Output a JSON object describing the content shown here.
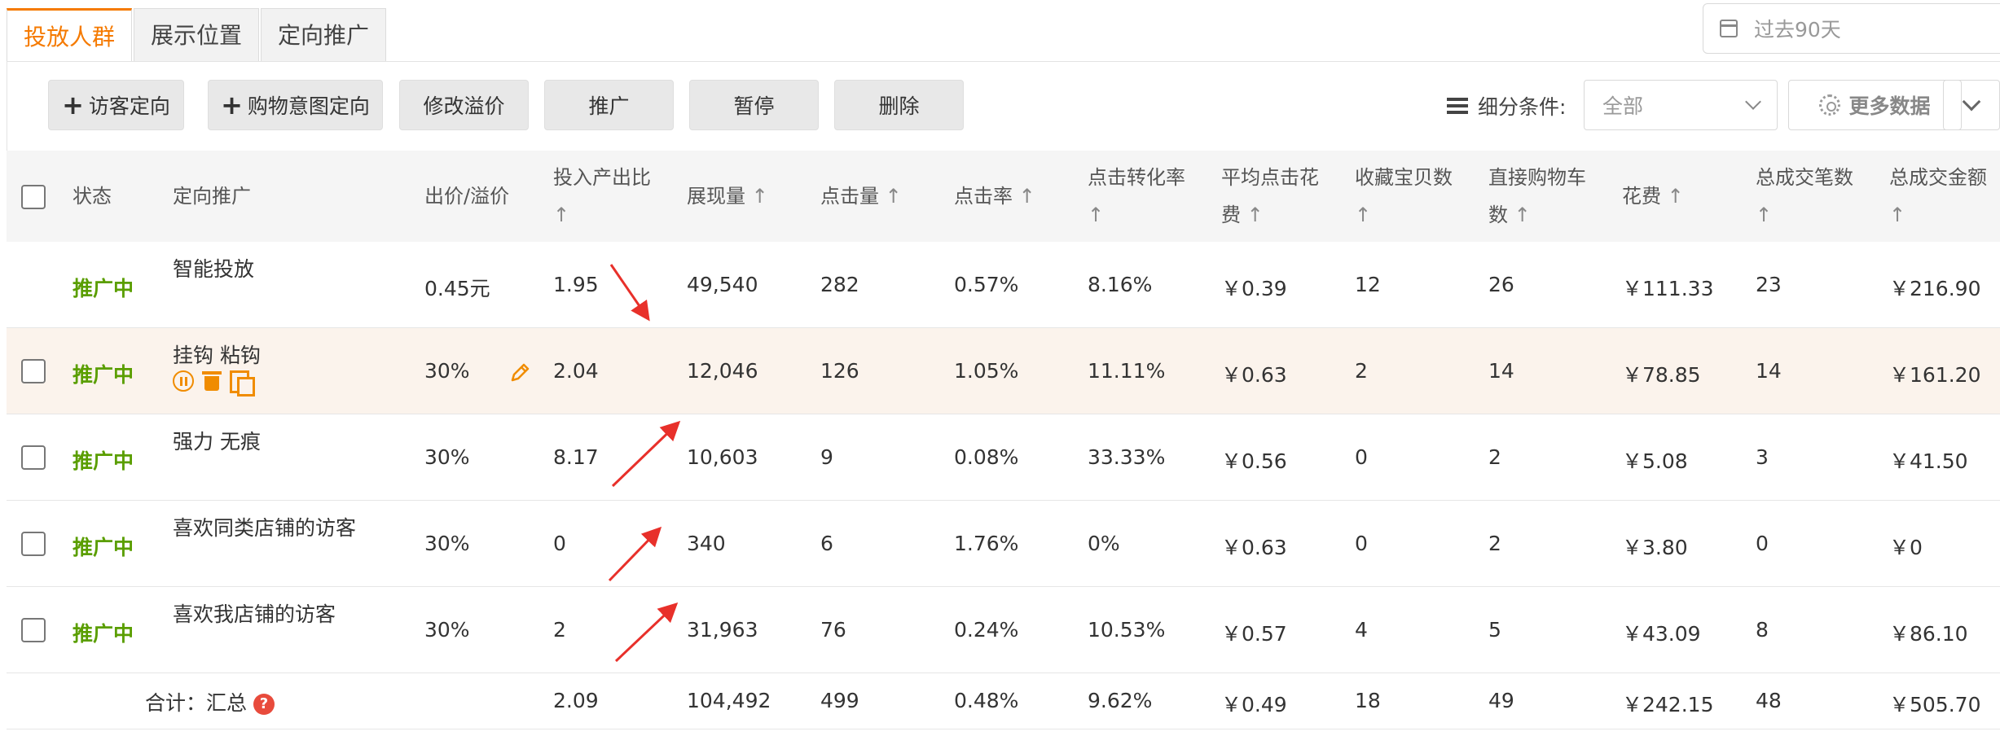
{
  "tabs": [
    {
      "label": "投放人群",
      "active": true
    },
    {
      "label": "展示位置",
      "active": false
    },
    {
      "label": "定向推广",
      "active": false
    }
  ],
  "date_range": {
    "label": "过去90天"
  },
  "toolbar": {
    "visitor_targeting": "访客定向",
    "intent_targeting": "购物意图定向",
    "modify_premium": "修改溢价",
    "promote": "推广",
    "pause": "暂停",
    "delete": "删除"
  },
  "filter": {
    "label": "细分条件:",
    "selected": "全部"
  },
  "more_data": "更多数据",
  "columns": {
    "status": "状态",
    "targeting": "定向推广",
    "bid": "出价/溢价",
    "roi": "投入产出比",
    "impressions": "展现量",
    "clicks": "点击量",
    "ctr": "点击率",
    "cvr": "点击转化率",
    "cpc_1": "平均点击花",
    "cpc_2": "费",
    "favorites": "收藏宝贝数",
    "cart_1": "直接购物车",
    "cart_2": "数",
    "cost": "花费",
    "orders_1": "总成交笔数",
    "amount": "总成交金额",
    "sort_arrow": "↑"
  },
  "rows": [
    {
      "status": "推广中",
      "name": "智能投放",
      "bid": "0.45元",
      "roi": "1.95",
      "impressions": "49,540",
      "clicks": "282",
      "ctr": "0.57%",
      "cvr": "8.16%",
      "cpc": "￥0.39",
      "favorites": "12",
      "cart": "26",
      "cost": "￥111.33",
      "orders": "23",
      "amount": "￥216.90"
    },
    {
      "status": "推广中",
      "name": "挂钩 粘钩",
      "bid": "30%",
      "roi": "2.04",
      "impressions": "12,046",
      "clicks": "126",
      "ctr": "1.05%",
      "cvr": "11.11%",
      "cpc": "￥0.63",
      "favorites": "2",
      "cart": "14",
      "cost": "￥78.85",
      "orders": "14",
      "amount": "￥161.20"
    },
    {
      "status": "推广中",
      "name": "强力 无痕",
      "bid": "30%",
      "roi": "8.17",
      "impressions": "10,603",
      "clicks": "9",
      "ctr": "0.08%",
      "cvr": "33.33%",
      "cpc": "￥0.56",
      "favorites": "0",
      "cart": "2",
      "cost": "￥5.08",
      "orders": "3",
      "amount": "￥41.50"
    },
    {
      "status": "推广中",
      "name": "喜欢同类店铺的访客",
      "bid": "30%",
      "roi": "0",
      "impressions": "340",
      "clicks": "6",
      "ctr": "1.76%",
      "cvr": "0%",
      "cpc": "￥0.63",
      "favorites": "0",
      "cart": "2",
      "cost": "￥3.80",
      "orders": "0",
      "amount": "￥0"
    },
    {
      "status": "推广中",
      "name": "喜欢我店铺的访客",
      "bid": "30%",
      "roi": "2",
      "impressions": "31,963",
      "clicks": "76",
      "ctr": "0.24%",
      "cvr": "10.53%",
      "cpc": "￥0.57",
      "favorites": "4",
      "cart": "5",
      "cost": "￥43.09",
      "orders": "8",
      "amount": "￥86.10"
    }
  ],
  "summary": {
    "label": "合计：汇总",
    "help": "?",
    "roi": "2.09",
    "impressions": "104,492",
    "clicks": "499",
    "ctr": "0.48%",
    "cvr": "9.62%",
    "cpc": "￥0.49",
    "favorites": "18",
    "cart": "49",
    "cost": "￥242.15",
    "orders": "48",
    "amount": "￥505.70"
  },
  "colors": {
    "accent": "#f57a00",
    "status_green": "#5a9e00",
    "annotation_arrow": "#e8302a",
    "highlight_row": "#fbf3ec"
  },
  "icons": {
    "calendar": "calendar-icon",
    "list": "list-icon",
    "gear": "gear-icon",
    "pause": "pause-icon",
    "trash": "trash-icon",
    "copy": "copy-icon",
    "edit": "pencil-icon",
    "help": "help-icon"
  }
}
